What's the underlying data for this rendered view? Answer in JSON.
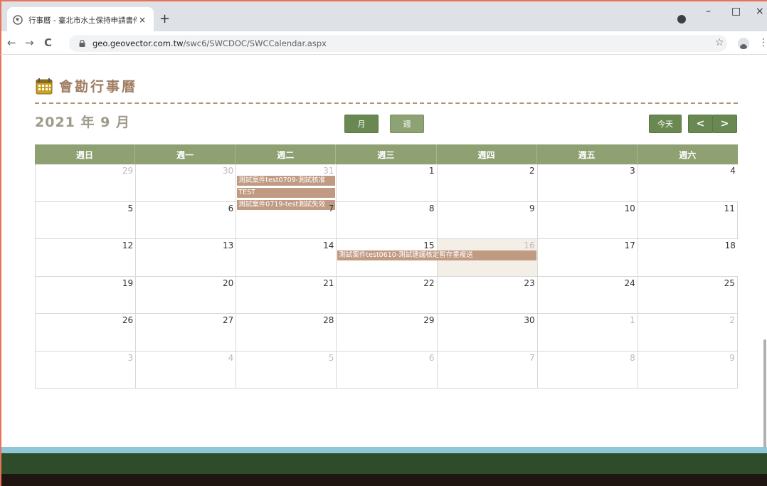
{
  "browser": {
    "tab_title": "行事曆 - 臺北市水土保持申請書件",
    "tab_close": "×",
    "new_tab": "+",
    "url_domain": "geo.geovector.com.tw",
    "url_path": "/swc6/SWCDOC/SWCCalendar.aspx",
    "back": "←",
    "forward": "→",
    "reload": "C",
    "bookmark": "☆",
    "menu": "⋮",
    "minimize": "–",
    "maximize": "□",
    "close": "×"
  },
  "page": {
    "heading": "會勘行事曆",
    "month_title": "2021 年 9 月",
    "view_month": "月",
    "view_week": "週",
    "today": "今天",
    "prev": "<",
    "next": ">"
  },
  "calendar": {
    "weekdays": [
      "週日",
      "週一",
      "週二",
      "週三",
      "週四",
      "週五",
      "週六"
    ],
    "weeks": [
      [
        {
          "d": "29",
          "o": true
        },
        {
          "d": "30",
          "o": true
        },
        {
          "d": "31",
          "o": true
        },
        {
          "d": "1"
        },
        {
          "d": "2"
        },
        {
          "d": "3"
        },
        {
          "d": "4"
        }
      ],
      [
        {
          "d": "5"
        },
        {
          "d": "6"
        },
        {
          "d": "7"
        },
        {
          "d": "8"
        },
        {
          "d": "9"
        },
        {
          "d": "10"
        },
        {
          "d": "11"
        }
      ],
      [
        {
          "d": "12"
        },
        {
          "d": "13"
        },
        {
          "d": "14"
        },
        {
          "d": "15"
        },
        {
          "d": "16",
          "today": true
        },
        {
          "d": "17"
        },
        {
          "d": "18"
        }
      ],
      [
        {
          "d": "19"
        },
        {
          "d": "20"
        },
        {
          "d": "21"
        },
        {
          "d": "22"
        },
        {
          "d": "23"
        },
        {
          "d": "24"
        },
        {
          "d": "25"
        }
      ],
      [
        {
          "d": "26"
        },
        {
          "d": "27"
        },
        {
          "d": "28"
        },
        {
          "d": "29"
        },
        {
          "d": "30"
        },
        {
          "d": "1",
          "o": true
        },
        {
          "d": "2",
          "o": true
        }
      ],
      [
        {
          "d": "3",
          "o": true
        },
        {
          "d": "4",
          "o": true
        },
        {
          "d": "5",
          "o": true
        },
        {
          "d": "6",
          "o": true
        },
        {
          "d": "7",
          "o": true
        },
        {
          "d": "8",
          "o": true
        },
        {
          "d": "9",
          "o": true
        }
      ]
    ],
    "events": [
      {
        "title": "測試案件test0709-測試核准",
        "week": 0,
        "start": 2,
        "span": 1,
        "slot": 0
      },
      {
        "title": "TEST",
        "week": 0,
        "start": 2,
        "span": 1,
        "slot": 1
      },
      {
        "title": "測試案件0719-test測試失效",
        "week": 0,
        "start": 2,
        "span": 1,
        "slot": 2
      },
      {
        "title": "測試案件test0610-測試建議核定暫存重複送",
        "week": 2,
        "start": 3,
        "span": 2,
        "slot": 0
      }
    ]
  },
  "colors": {
    "accent_green": "#6a8952",
    "header_green": "#8fa073",
    "event_tan": "#c09a82",
    "heading_brown": "#a07e63"
  }
}
